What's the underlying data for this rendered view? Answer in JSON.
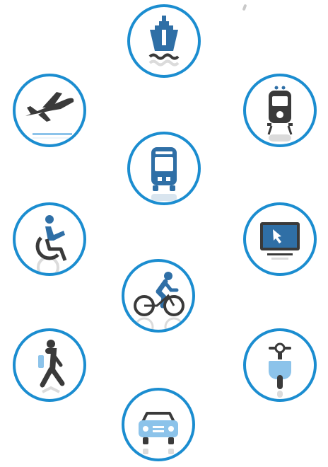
{
  "colors": {
    "ring": "#1b8dd0",
    "icon_dark": "#3a3a3a",
    "icon_blue": "#2f6fa6",
    "icon_light_blue": "#8cc3ea"
  },
  "icons": [
    {
      "id": "ship",
      "icon": "ship-icon"
    },
    {
      "id": "airplane",
      "icon": "airplane-icon"
    },
    {
      "id": "train",
      "icon": "train-icon"
    },
    {
      "id": "bus",
      "icon": "bus-icon"
    },
    {
      "id": "wheelchair",
      "icon": "wheelchair-icon"
    },
    {
      "id": "monitor",
      "icon": "monitor-cursor-icon"
    },
    {
      "id": "bicycle",
      "icon": "bicycle-icon"
    },
    {
      "id": "pedestrian",
      "icon": "pedestrian-icon"
    },
    {
      "id": "scooter",
      "icon": "scooter-icon"
    },
    {
      "id": "car",
      "icon": "car-icon"
    }
  ]
}
